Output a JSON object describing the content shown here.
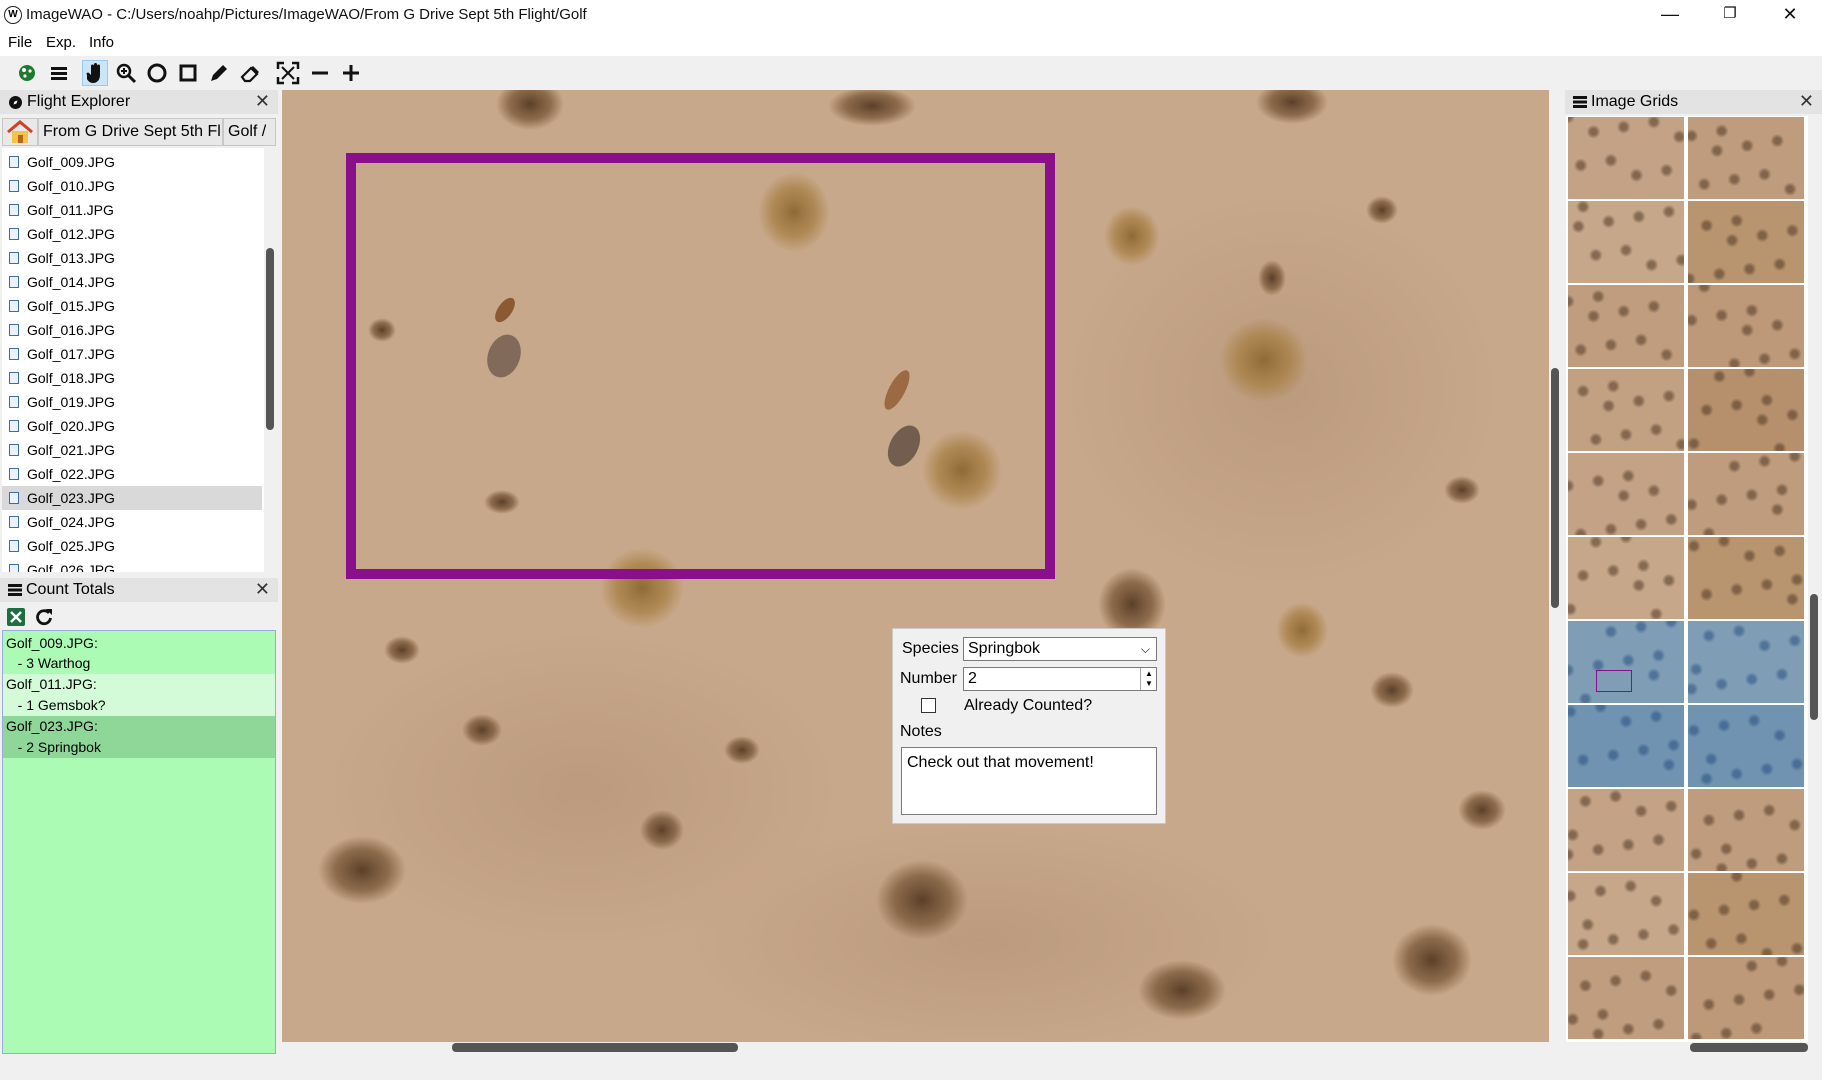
{
  "window": {
    "title": "ImageWAO - C:/Users/noahp/Pictures/ImageWAO/From G Drive Sept 5th Flight/Golf",
    "icon": "app-logo-icon",
    "minimize": "—",
    "maximize": "❐",
    "close": "✕"
  },
  "menu": [
    "File",
    "Exp.",
    "Info"
  ],
  "toolbar": {
    "tools": [
      "palette-icon",
      "layers-icon",
      "hand-icon",
      "zoom-icon",
      "ellipse-icon",
      "rectangle-icon",
      "pencil-icon",
      "eraser-icon",
      "fit-icon",
      "zoom-out-icon",
      "zoom-in-icon"
    ],
    "active_tool": "hand-icon"
  },
  "flight_explorer": {
    "title": "Flight Explorer",
    "breadcrumb": [
      "From G Drive Sept 5th Fl",
      "Golf /"
    ],
    "files": [
      "Golf_009.JPG",
      "Golf_010.JPG",
      "Golf_011.JPG",
      "Golf_012.JPG",
      "Golf_013.JPG",
      "Golf_014.JPG",
      "Golf_015.JPG",
      "Golf_016.JPG",
      "Golf_017.JPG",
      "Golf_018.JPG",
      "Golf_019.JPG",
      "Golf_020.JPG",
      "Golf_021.JPG",
      "Golf_022.JPG",
      "Golf_023.JPG",
      "Golf_024.JPG",
      "Golf_025.JPG",
      "Golf_026.JPG"
    ],
    "selected": "Golf_023.JPG"
  },
  "count_totals": {
    "title": "Count Totals",
    "rows": [
      "Golf_009.JPG:",
      "   - 3 Warthog",
      "Golf_011.JPG:",
      "   - 1 Gemsbok?",
      "Golf_023.JPG:",
      "   - 2 Springbok"
    ]
  },
  "annotation_popup": {
    "species_label": "Species",
    "species_value": "Springbok",
    "number_label": "Number",
    "number_value": "2",
    "already_counted_label": "Already Counted?",
    "already_counted": false,
    "notes_label": "Notes",
    "notes_value": "Check out that movement!"
  },
  "annotation_color": "#8a0f8a",
  "image_grids": {
    "title": "Image Grids"
  }
}
